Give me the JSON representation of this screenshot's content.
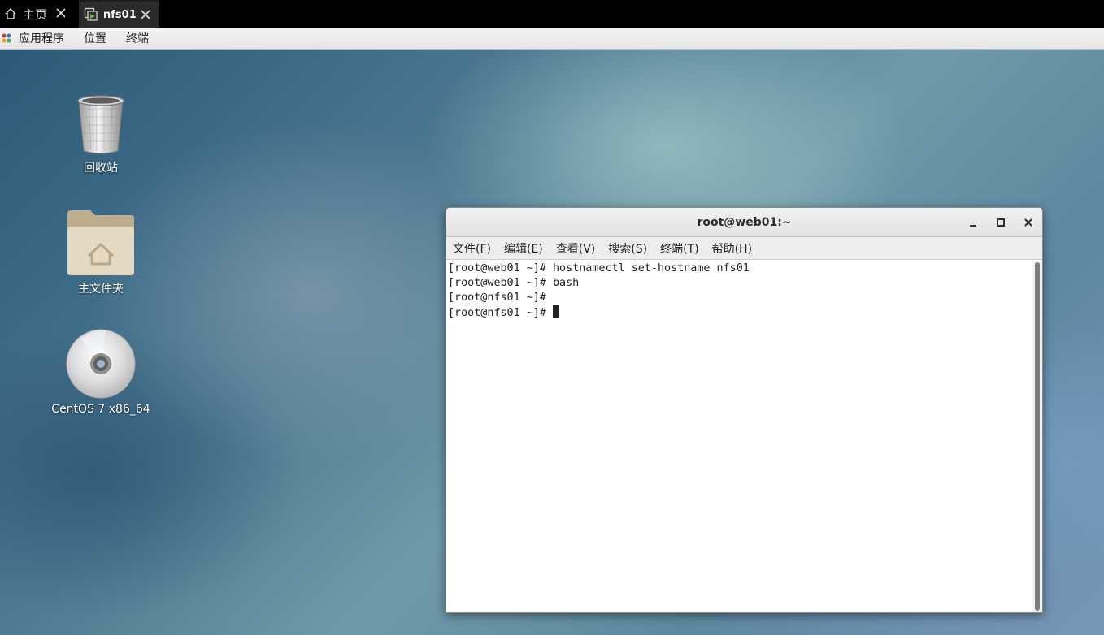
{
  "tabs": [
    {
      "label": "主页",
      "icon": "home-icon"
    },
    {
      "label": "nfs01",
      "icon": "vm-icon"
    }
  ],
  "panel": {
    "items": [
      "应用程序",
      "位置",
      "终端"
    ]
  },
  "desktop": {
    "icons": [
      {
        "label": "回收站",
        "icon": "trash-icon"
      },
      {
        "label": "主文件夹",
        "icon": "home-folder-icon"
      },
      {
        "label": "CentOS 7 x86_64",
        "icon": "disc-icon"
      }
    ]
  },
  "terminal": {
    "title": "root@web01:~",
    "menu": [
      "文件(F)",
      "编辑(E)",
      "查看(V)",
      "搜索(S)",
      "终端(T)",
      "帮助(H)"
    ],
    "lines": [
      "[root@web01 ~]# hostnamectl set-hostname nfs01",
      "[root@web01 ~]# bash",
      "[root@nfs01 ~]#",
      "[root@nfs01 ~]# "
    ]
  }
}
